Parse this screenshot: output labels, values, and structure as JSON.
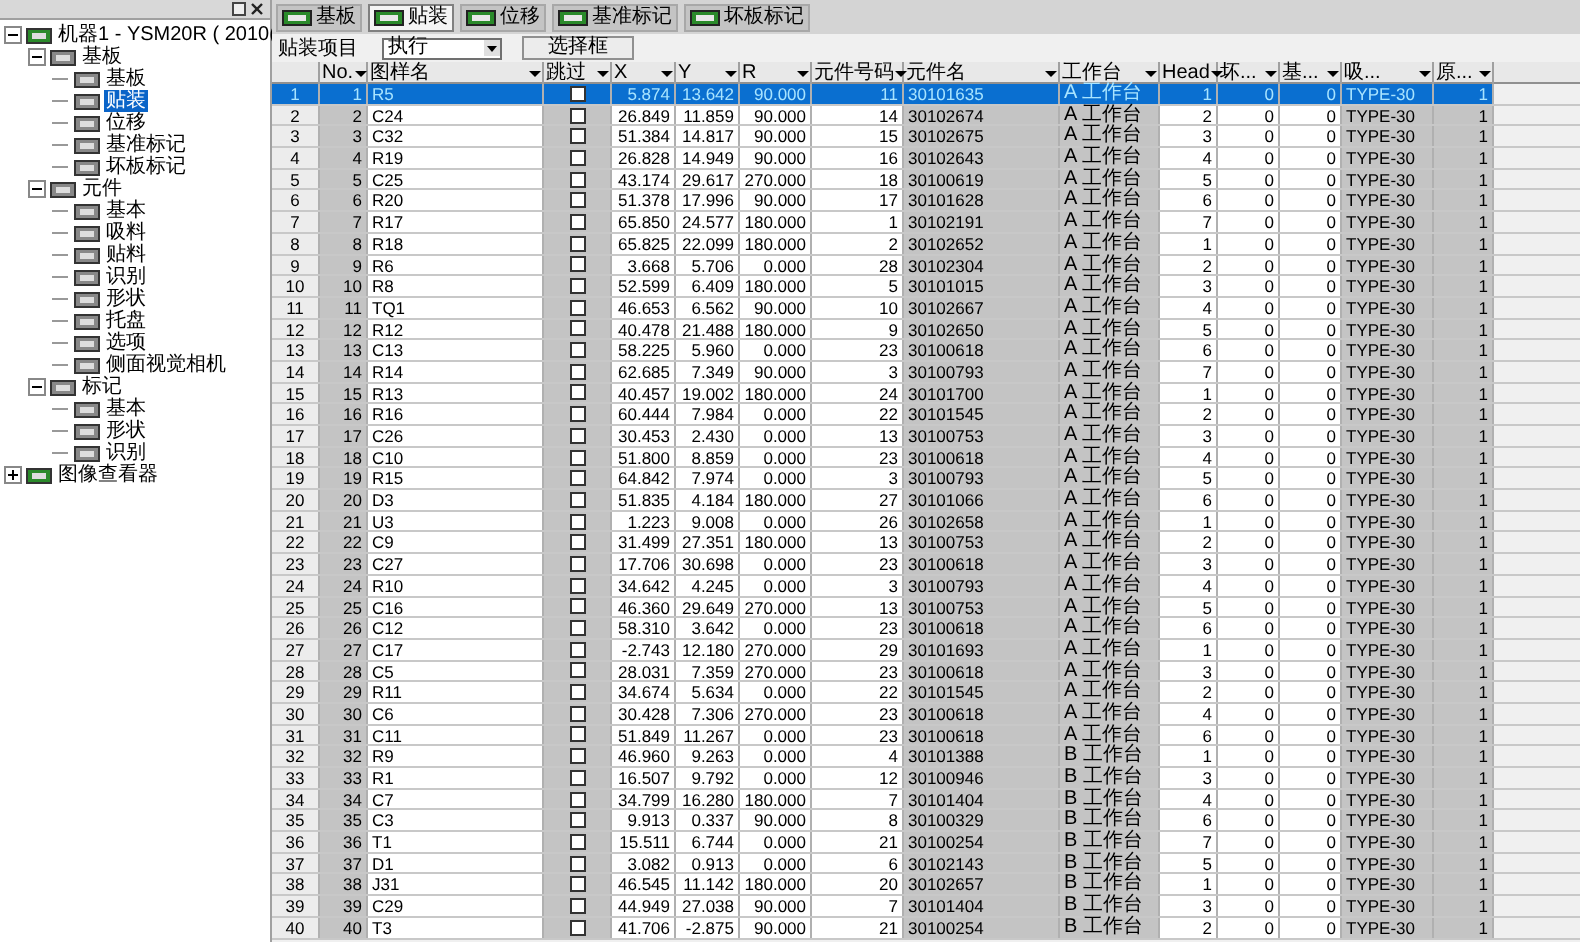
{
  "tree": [
    {
      "label": "机器1 - YSM20R ( 2010(",
      "expanded": true,
      "children": [
        {
          "label": "基板",
          "expanded": true,
          "children": [
            {
              "label": "基板",
              "selected": false
            },
            {
              "label": "贴装",
              "selected": true
            },
            {
              "label": "位移",
              "selected": false
            },
            {
              "label": "基准标记",
              "selected": false
            },
            {
              "label": "坏板标记",
              "selected": false
            }
          ]
        },
        {
          "label": "元件",
          "expanded": true,
          "children": [
            {
              "label": "基本",
              "selected": false
            },
            {
              "label": "吸料",
              "selected": false
            },
            {
              "label": "贴料",
              "selected": false
            },
            {
              "label": "识别",
              "selected": false
            },
            {
              "label": "形状",
              "selected": false
            },
            {
              "label": "托盘",
              "selected": false
            },
            {
              "label": "选项",
              "selected": false
            },
            {
              "label": "侧面视觉相机",
              "selected": false
            }
          ]
        },
        {
          "label": "标记",
          "expanded": true,
          "children": [
            {
              "label": "基本",
              "selected": false
            },
            {
              "label": "形状",
              "selected": false
            },
            {
              "label": "识别",
              "selected": false
            }
          ]
        }
      ]
    },
    {
      "label": "图像查看器",
      "expanded": false
    }
  ],
  "tabs": [
    {
      "label": "基板",
      "selected": false
    },
    {
      "label": "贴装",
      "selected": true
    },
    {
      "label": "位移",
      "selected": false
    },
    {
      "label": "基准标记",
      "selected": false
    },
    {
      "label": "坏板标记",
      "selected": false
    }
  ],
  "toolbar": {
    "label": "贴装项目",
    "select_value": "执行",
    "button": "选择框"
  },
  "table": {
    "columns": [
      {
        "kind": "rownum"
      },
      {
        "label": "No.",
        "kind": "num"
      },
      {
        "label": "图样名",
        "kind": "text"
      },
      {
        "label": "跳过",
        "kind": "check"
      },
      {
        "label": "X",
        "kind": "num"
      },
      {
        "label": "Y",
        "kind": "num"
      },
      {
        "label": "R",
        "kind": "num"
      },
      {
        "label": "元件号码",
        "kind": "num"
      },
      {
        "label": "元件名",
        "kind": "text"
      },
      {
        "label": "工作台",
        "kind": "station"
      },
      {
        "label": "Head",
        "kind": "num"
      },
      {
        "label": "坏...",
        "kind": "num"
      },
      {
        "label": "基...",
        "kind": "num"
      },
      {
        "label": "吸...",
        "kind": "text"
      },
      {
        "label": "原...",
        "kind": "num"
      }
    ],
    "rows": [
      {
        "selected": true,
        "skipped": false,
        "cells": [
          "1",
          "1",
          "R5",
          "",
          "5.874",
          "13.642",
          "90.000",
          "11",
          "30101635",
          "A 工作台",
          "1",
          "0",
          "0",
          "TYPE-30",
          "1"
        ]
      },
      {
        "selected": false,
        "skipped": false,
        "cells": [
          "2",
          "2",
          "C24",
          "",
          "26.849",
          "11.859",
          "90.000",
          "14",
          "30102674",
          "A 工作台",
          "2",
          "0",
          "0",
          "TYPE-30",
          "1"
        ]
      },
      {
        "selected": false,
        "skipped": false,
        "cells": [
          "3",
          "3",
          "C32",
          "",
          "51.384",
          "14.817",
          "90.000",
          "15",
          "30102675",
          "A 工作台",
          "3",
          "0",
          "0",
          "TYPE-30",
          "1"
        ]
      },
      {
        "selected": false,
        "skipped": false,
        "cells": [
          "4",
          "4",
          "R19",
          "",
          "26.828",
          "14.949",
          "90.000",
          "16",
          "30102643",
          "A 工作台",
          "4",
          "0",
          "0",
          "TYPE-30",
          "1"
        ]
      },
      {
        "selected": false,
        "skipped": false,
        "cells": [
          "5",
          "5",
          "C25",
          "",
          "43.174",
          "29.617",
          "270.000",
          "18",
          "30100619",
          "A 工作台",
          "5",
          "0",
          "0",
          "TYPE-30",
          "1"
        ]
      },
      {
        "selected": false,
        "skipped": false,
        "cells": [
          "6",
          "6",
          "R20",
          "",
          "51.378",
          "17.996",
          "90.000",
          "17",
          "30101628",
          "A 工作台",
          "6",
          "0",
          "0",
          "TYPE-30",
          "1"
        ]
      },
      {
        "selected": false,
        "skipped": false,
        "cells": [
          "7",
          "7",
          "R17",
          "",
          "65.850",
          "24.577",
          "180.000",
          "1",
          "30102191",
          "A 工作台",
          "7",
          "0",
          "0",
          "TYPE-30",
          "1"
        ]
      },
      {
        "selected": false,
        "skipped": false,
        "cells": [
          "8",
          "8",
          "R18",
          "",
          "65.825",
          "22.099",
          "180.000",
          "2",
          "30102652",
          "A 工作台",
          "1",
          "0",
          "0",
          "TYPE-30",
          "1"
        ]
      },
      {
        "selected": false,
        "skipped": false,
        "cells": [
          "9",
          "9",
          "R6",
          "",
          "3.668",
          "5.706",
          "0.000",
          "28",
          "30102304",
          "A 工作台",
          "2",
          "0",
          "0",
          "TYPE-30",
          "1"
        ]
      },
      {
        "selected": false,
        "skipped": false,
        "cells": [
          "10",
          "10",
          "R8",
          "",
          "52.599",
          "6.409",
          "180.000",
          "5",
          "30101015",
          "A 工作台",
          "3",
          "0",
          "0",
          "TYPE-30",
          "1"
        ]
      },
      {
        "selected": false,
        "skipped": false,
        "cells": [
          "11",
          "11",
          "TQ1",
          "",
          "46.653",
          "6.562",
          "90.000",
          "10",
          "30102667",
          "A 工作台",
          "4",
          "0",
          "0",
          "TYPE-30",
          "1"
        ]
      },
      {
        "selected": false,
        "skipped": false,
        "cells": [
          "12",
          "12",
          "R12",
          "",
          "40.478",
          "21.488",
          "180.000",
          "9",
          "30102650",
          "A 工作台",
          "5",
          "0",
          "0",
          "TYPE-30",
          "1"
        ]
      },
      {
        "selected": false,
        "skipped": false,
        "cells": [
          "13",
          "13",
          "C13",
          "",
          "58.225",
          "5.960",
          "0.000",
          "23",
          "30100618",
          "A 工作台",
          "6",
          "0",
          "0",
          "TYPE-30",
          "1"
        ]
      },
      {
        "selected": false,
        "skipped": false,
        "cells": [
          "14",
          "14",
          "R14",
          "",
          "62.685",
          "7.349",
          "90.000",
          "3",
          "30100793",
          "A 工作台",
          "7",
          "0",
          "0",
          "TYPE-30",
          "1"
        ]
      },
      {
        "selected": false,
        "skipped": false,
        "cells": [
          "15",
          "15",
          "R13",
          "",
          "40.457",
          "19.002",
          "180.000",
          "24",
          "30101700",
          "A 工作台",
          "1",
          "0",
          "0",
          "TYPE-30",
          "1"
        ]
      },
      {
        "selected": false,
        "skipped": false,
        "cells": [
          "16",
          "16",
          "R16",
          "",
          "60.444",
          "7.984",
          "0.000",
          "22",
          "30101545",
          "A 工作台",
          "2",
          "0",
          "0",
          "TYPE-30",
          "1"
        ]
      },
      {
        "selected": false,
        "skipped": false,
        "cells": [
          "17",
          "17",
          "C26",
          "",
          "30.453",
          "2.430",
          "0.000",
          "13",
          "30100753",
          "A 工作台",
          "3",
          "0",
          "0",
          "TYPE-30",
          "1"
        ]
      },
      {
        "selected": false,
        "skipped": false,
        "cells": [
          "18",
          "18",
          "C10",
          "",
          "51.800",
          "8.859",
          "0.000",
          "23",
          "30100618",
          "A 工作台",
          "4",
          "0",
          "0",
          "TYPE-30",
          "1"
        ]
      },
      {
        "selected": false,
        "skipped": false,
        "cells": [
          "19",
          "19",
          "R15",
          "",
          "64.842",
          "7.974",
          "0.000",
          "3",
          "30100793",
          "A 工作台",
          "5",
          "0",
          "0",
          "TYPE-30",
          "1"
        ]
      },
      {
        "selected": false,
        "skipped": false,
        "cells": [
          "20",
          "20",
          "D3",
          "",
          "51.835",
          "4.184",
          "180.000",
          "27",
          "30101066",
          "A 工作台",
          "6",
          "0",
          "0",
          "TYPE-30",
          "1"
        ]
      },
      {
        "selected": false,
        "skipped": false,
        "cells": [
          "21",
          "21",
          "U3",
          "",
          "1.223",
          "9.008",
          "0.000",
          "26",
          "30102658",
          "A 工作台",
          "1",
          "0",
          "0",
          "TYPE-30",
          "1"
        ]
      },
      {
        "selected": false,
        "skipped": false,
        "cells": [
          "22",
          "22",
          "C9",
          "",
          "31.499",
          "27.351",
          "180.000",
          "13",
          "30100753",
          "A 工作台",
          "2",
          "0",
          "0",
          "TYPE-30",
          "1"
        ]
      },
      {
        "selected": false,
        "skipped": false,
        "cells": [
          "23",
          "23",
          "C27",
          "",
          "17.706",
          "30.698",
          "0.000",
          "23",
          "30100618",
          "A 工作台",
          "3",
          "0",
          "0",
          "TYPE-30",
          "1"
        ]
      },
      {
        "selected": false,
        "skipped": false,
        "cells": [
          "24",
          "24",
          "R10",
          "",
          "34.642",
          "4.245",
          "0.000",
          "3",
          "30100793",
          "A 工作台",
          "4",
          "0",
          "0",
          "TYPE-30",
          "1"
        ]
      },
      {
        "selected": false,
        "skipped": false,
        "cells": [
          "25",
          "25",
          "C16",
          "",
          "46.360",
          "29.649",
          "270.000",
          "13",
          "30100753",
          "A 工作台",
          "5",
          "0",
          "0",
          "TYPE-30",
          "1"
        ]
      },
      {
        "selected": false,
        "skipped": false,
        "cells": [
          "26",
          "26",
          "C12",
          "",
          "58.310",
          "3.642",
          "0.000",
          "23",
          "30100618",
          "A 工作台",
          "6",
          "0",
          "0",
          "TYPE-30",
          "1"
        ]
      },
      {
        "selected": false,
        "skipped": false,
        "cells": [
          "27",
          "27",
          "C17",
          "",
          "-2.743",
          "12.180",
          "270.000",
          "29",
          "30101693",
          "A 工作台",
          "1",
          "0",
          "0",
          "TYPE-30",
          "1"
        ]
      },
      {
        "selected": false,
        "skipped": false,
        "cells": [
          "28",
          "28",
          "C5",
          "",
          "28.031",
          "7.359",
          "270.000",
          "23",
          "30100618",
          "A 工作台",
          "3",
          "0",
          "0",
          "TYPE-30",
          "1"
        ]
      },
      {
        "selected": false,
        "skipped": false,
        "cells": [
          "29",
          "29",
          "R11",
          "",
          "34.674",
          "5.634",
          "0.000",
          "22",
          "30101545",
          "A 工作台",
          "2",
          "0",
          "0",
          "TYPE-30",
          "1"
        ]
      },
      {
        "selected": false,
        "skipped": false,
        "cells": [
          "30",
          "30",
          "C6",
          "",
          "30.428",
          "7.306",
          "270.000",
          "23",
          "30100618",
          "A 工作台",
          "4",
          "0",
          "0",
          "TYPE-30",
          "1"
        ]
      },
      {
        "selected": false,
        "skipped": false,
        "cells": [
          "31",
          "31",
          "C11",
          "",
          "51.849",
          "11.267",
          "0.000",
          "23",
          "30100618",
          "A 工作台",
          "6",
          "0",
          "0",
          "TYPE-30",
          "1"
        ]
      },
      {
        "selected": false,
        "skipped": false,
        "cells": [
          "32",
          "32",
          "R9",
          "",
          "46.960",
          "9.263",
          "0.000",
          "4",
          "30101388",
          "B 工作台",
          "1",
          "0",
          "0",
          "TYPE-30",
          "1"
        ]
      },
      {
        "selected": false,
        "skipped": false,
        "cells": [
          "33",
          "33",
          "R1",
          "",
          "16.507",
          "9.792",
          "0.000",
          "12",
          "30100946",
          "B 工作台",
          "3",
          "0",
          "0",
          "TYPE-30",
          "1"
        ]
      },
      {
        "selected": false,
        "skipped": false,
        "cells": [
          "34",
          "34",
          "C7",
          "",
          "34.799",
          "16.280",
          "180.000",
          "7",
          "30101404",
          "B 工作台",
          "4",
          "0",
          "0",
          "TYPE-30",
          "1"
        ]
      },
      {
        "selected": false,
        "skipped": false,
        "cells": [
          "35",
          "35",
          "C3",
          "",
          "9.913",
          "0.337",
          "90.000",
          "8",
          "30100329",
          "B 工作台",
          "6",
          "0",
          "0",
          "TYPE-30",
          "1"
        ]
      },
      {
        "selected": false,
        "skipped": false,
        "cells": [
          "36",
          "36",
          "T1",
          "",
          "15.511",
          "6.744",
          "0.000",
          "21",
          "30100254",
          "B 工作台",
          "7",
          "0",
          "0",
          "TYPE-30",
          "1"
        ]
      },
      {
        "selected": false,
        "skipped": false,
        "cells": [
          "37",
          "37",
          "D1",
          "",
          "3.082",
          "0.913",
          "0.000",
          "6",
          "30102143",
          "B 工作台",
          "5",
          "0",
          "0",
          "TYPE-30",
          "1"
        ]
      },
      {
        "selected": false,
        "skipped": false,
        "cells": [
          "38",
          "38",
          "J31",
          "",
          "46.545",
          "11.142",
          "180.000",
          "20",
          "30102657",
          "B 工作台",
          "1",
          "0",
          "0",
          "TYPE-30",
          "1"
        ]
      },
      {
        "selected": false,
        "skipped": false,
        "cells": [
          "39",
          "39",
          "C29",
          "",
          "44.949",
          "27.038",
          "90.000",
          "7",
          "30101404",
          "B 工作台",
          "3",
          "0",
          "0",
          "TYPE-30",
          "1"
        ]
      },
      {
        "selected": false,
        "skipped": false,
        "cells": [
          "40",
          "40",
          "T3",
          "",
          "41.706",
          "-2.875",
          "90.000",
          "21",
          "30100254",
          "B 工作台",
          "2",
          "0",
          "0",
          "TYPE-30",
          "1"
        ]
      }
    ]
  }
}
